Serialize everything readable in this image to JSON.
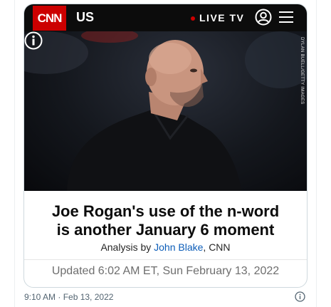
{
  "header": {
    "logo_text": "CNN",
    "section": "US",
    "live_label": "LIVE TV"
  },
  "photo": {
    "credit": "DYLAN BUELL/GETTY IMAGES"
  },
  "article": {
    "headline_line1": "Joe Rogan's use of the n-word",
    "headline_line2": "is another January 6 moment",
    "byline_prefix": "Analysis by ",
    "author": "John Blake",
    "byline_suffix": ", CNN",
    "updated": "Updated 6:02 AM ET, Sun February 13, 2022"
  },
  "tweet": {
    "timestamp": "9:10 AM · Feb 13, 2022"
  },
  "colors": {
    "cnn_red": "#cc0000",
    "header_bg": "#0c0c0c",
    "link_blue": "#0c5db8",
    "muted_gray": "#6e6e6e"
  },
  "icons": [
    "account-icon",
    "menu-icon",
    "info-icon",
    "tweet-info-icon"
  ]
}
